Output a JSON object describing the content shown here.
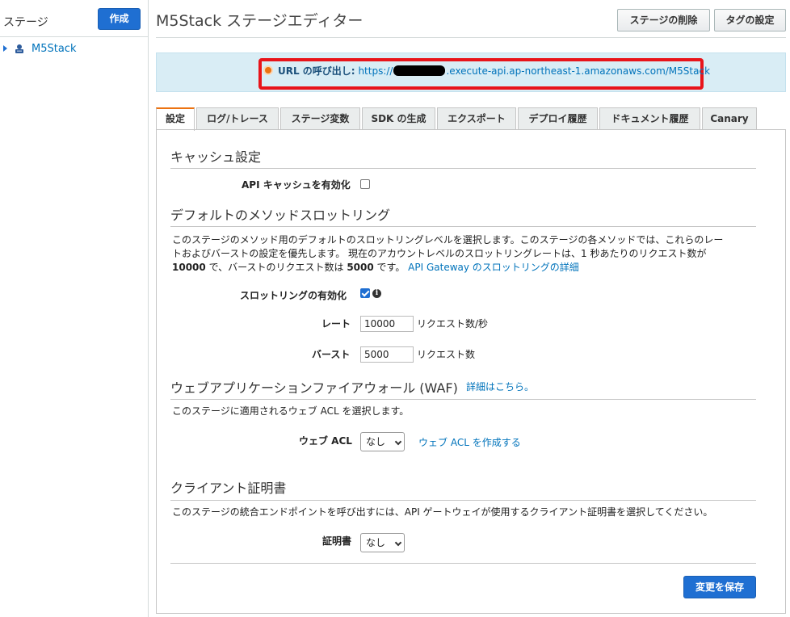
{
  "sidebar": {
    "title": "ステージ",
    "create_label": "作成",
    "tree": [
      {
        "label": "M5Stack",
        "icon": "stage-icon"
      }
    ]
  },
  "header": {
    "title": "M5Stack ステージエディター",
    "delete_stage_label": "ステージの削除",
    "tag_settings_label": "タグの設定"
  },
  "invoke_url": {
    "label": "URL の呼び出し:",
    "prefix": "https://",
    "suffix": ".execute-api.ap-northeast-1.amazonaws.com/M5Stack",
    "highlight_color": "#e8141a"
  },
  "tabs": [
    {
      "label": "設定",
      "active": true
    },
    {
      "label": "ログ/トレース"
    },
    {
      "label": "ステージ変数"
    },
    {
      "label": "SDK の生成"
    },
    {
      "label": "エクスポート"
    },
    {
      "label": "デプロイ履歴"
    },
    {
      "label": "ドキュメント履歴"
    },
    {
      "label": "Canary"
    }
  ],
  "cache": {
    "title": "キャッシュ設定",
    "enable_label": "API キャッシュを有効化",
    "enabled": false
  },
  "throttling": {
    "title": "デフォルトのメソッドスロットリング",
    "desc_line1": "このステージのメソッド用のデフォルトのスロットリングレベルを選択します。このステージの各メソッドでは、これらのレー",
    "desc_line2": "トおよびバーストの設定を優先します。 現在のアカウントレベルのスロットリングレートは、1 秒あたりのリクエスト数が",
    "desc_rate_value": "10000",
    "desc_mid": " で、バーストのリクエスト数は ",
    "desc_burst_value": "5000",
    "desc_end": " です。",
    "link": "API Gateway のスロットリングの詳細",
    "enable_label": "スロットリングの有効化",
    "enabled": true,
    "rate_label": "レート",
    "rate_value": "10000",
    "rate_unit": "リクエスト数/秒",
    "burst_label": "バースト",
    "burst_value": "5000",
    "burst_unit": "リクエスト数"
  },
  "waf": {
    "title": "ウェブアプリケーションファイアウォール (WAF)",
    "details_link": "詳細はこちら。",
    "desc": "このステージに適用されるウェブ ACL を選択します。",
    "acl_label": "ウェブ ACL",
    "acl_selected": "なし",
    "create_link": "ウェブ ACL を作成する"
  },
  "client_cert": {
    "title": "クライアント証明書",
    "desc": "このステージの統合エンドポイントを呼び出すには、API ゲートウェイが使用するクライアント証明書を選択してください。",
    "cert_label": "証明書",
    "cert_selected": "なし"
  },
  "save_label": "変更を保存"
}
